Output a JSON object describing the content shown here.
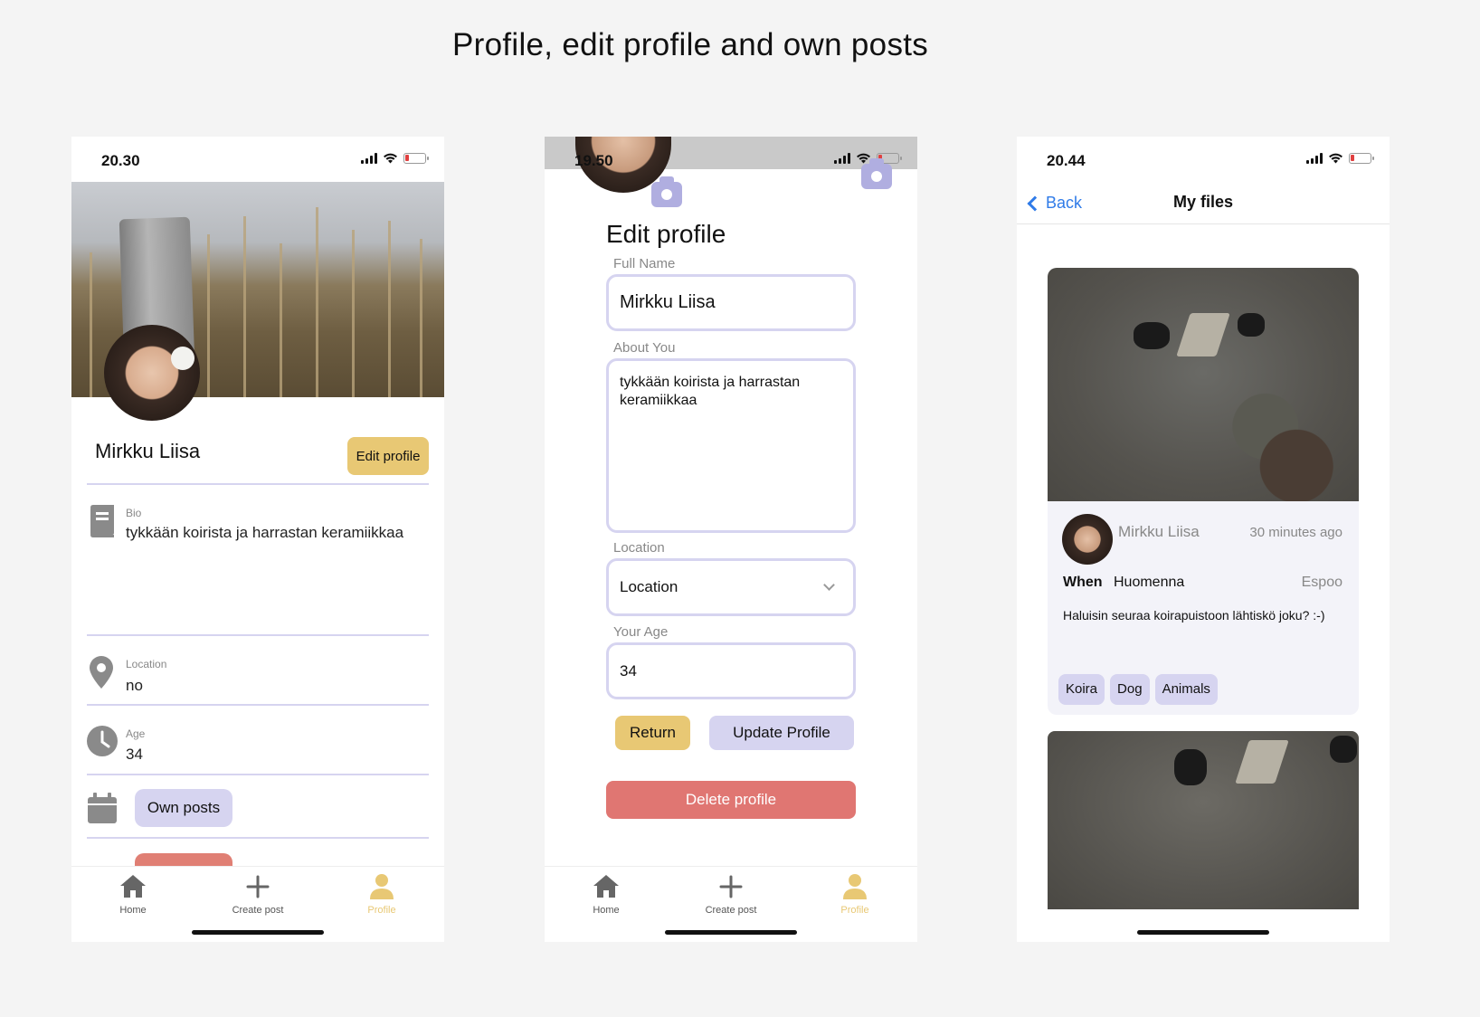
{
  "page": {
    "title": "Profile, edit profile and own posts"
  },
  "profile_screen": {
    "status_time": "20.30",
    "name": "Mirkku Liisa",
    "edit_button": "Edit profile",
    "bio_label": "Bio",
    "bio_value": "tykkään koirista ja harrastan keramiikkaa",
    "location_label": "Location",
    "location_value": "no",
    "age_label": "Age",
    "age_value": "34",
    "own_posts_button": "Own posts"
  },
  "edit_screen": {
    "status_time": "19.50",
    "heading": "Edit profile",
    "full_name_label": "Full Name",
    "full_name_value": "Mirkku Liisa",
    "about_label": "About You",
    "about_value": "tykkään koirista ja harrastan keramiikkaa",
    "location_label": "Location",
    "location_selected": "Location",
    "age_label": "Your Age",
    "age_value": "34",
    "return_button": "Return",
    "update_button": "Update Profile",
    "delete_button": "Delete profile"
  },
  "files_screen": {
    "status_time": "20.44",
    "back_label": "Back",
    "title": "My files",
    "post": {
      "author": "Mirkku Liisa",
      "time_ago": "30 minutes ago",
      "when_label": "When",
      "when_value": "Huomenna",
      "location": "Espoo",
      "text": "Haluisin seuraa koirapuistoon lähtiskö joku? :-)",
      "tags": [
        "Koira",
        "Dog",
        "Animals"
      ]
    }
  },
  "tabbar": {
    "items": [
      {
        "label": "Home",
        "icon": "home-icon"
      },
      {
        "label": "Create post",
        "icon": "plus-icon"
      },
      {
        "label": "Profile",
        "icon": "person-icon",
        "active": true
      }
    ]
  },
  "colors": {
    "accent_yellow": "#e8c874",
    "accent_lavender": "#d6d4f0",
    "danger_red": "#e07672",
    "link_blue": "#2f7be8"
  }
}
